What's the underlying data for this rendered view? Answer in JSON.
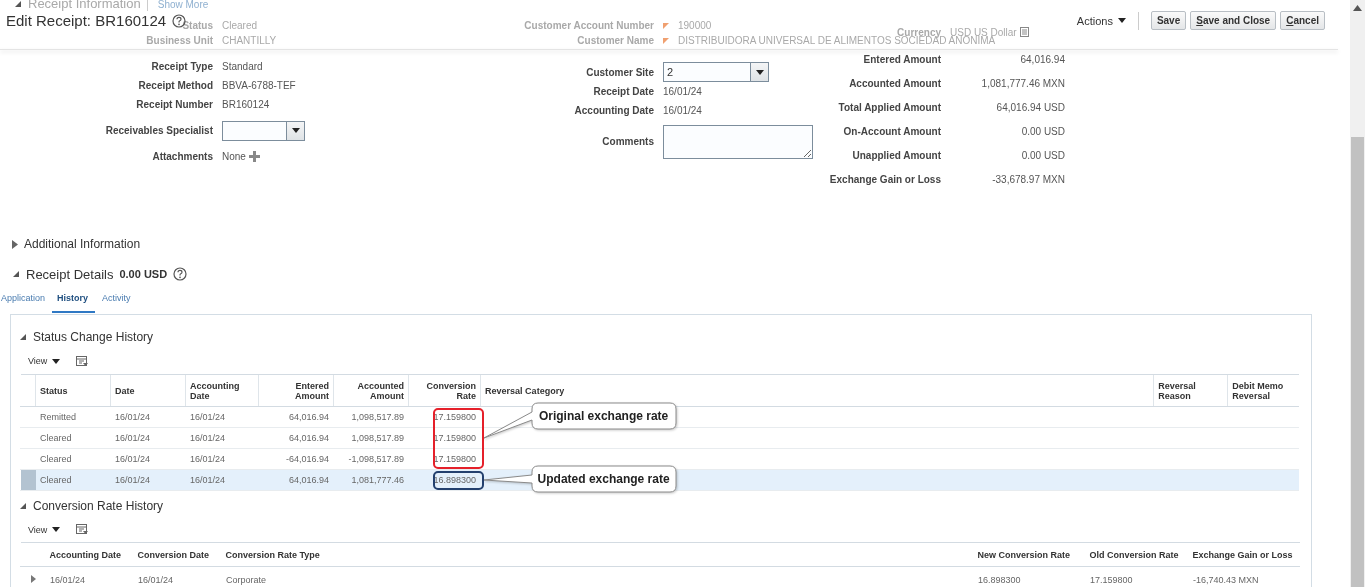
{
  "header": {
    "title": "Edit Receipt: BR160124",
    "actions_menu": "Actions",
    "buttons": [
      {
        "label": "Save",
        "underline_first": false
      },
      {
        "label": "Save and Close",
        "underline_first": true
      },
      {
        "label": "Cancel",
        "underline_first": true
      }
    ]
  },
  "receipt_information": {
    "title": "Receipt Information",
    "expanded": true,
    "dimmed": true,
    "show_more": "Show More",
    "column_1": [
      {
        "kind": "text",
        "label": "Status",
        "value": "Cleared",
        "dimmed": true
      },
      {
        "kind": "text",
        "label": "Business Unit",
        "value": "CHANTILLY",
        "dimmed": true
      },
      {
        "kind": "text",
        "label": "Receipt Type",
        "value": "Standard",
        "dimmed": false
      },
      {
        "kind": "text",
        "label": "Receipt Method",
        "value": "BBVA-6788-TEF",
        "dimmed": false
      },
      {
        "kind": "text",
        "label": "Receipt Number",
        "value": "BR160124",
        "dimmed": false
      },
      {
        "kind": "select",
        "label": "Receivables Specialist",
        "dimmed": false
      },
      {
        "kind": "attachments",
        "label": "Attachments",
        "value": "None",
        "dimmed": false
      }
    ],
    "column_2": [
      {
        "kind": "flagged",
        "label": "Customer Account Number",
        "value": "190000",
        "dimmed": true
      },
      {
        "kind": "flagged",
        "label": "Customer Name",
        "value": "DISTRIBUIDORA UNIVERSAL DE ALIMENTOS SOCIEDAD ANONIMA",
        "dimmed": true
      },
      {
        "kind": "select",
        "label": "Customer Site",
        "value": "2",
        "dimmed": false
      },
      {
        "kind": "text",
        "label": "Receipt Date",
        "value": "16/01/24",
        "dimmed": false
      },
      {
        "kind": "text",
        "label": "Accounting Date",
        "value": "16/01/24",
        "dimmed": false
      },
      {
        "kind": "textarea",
        "label": "Comments",
        "dimmed": false
      }
    ],
    "column_3": [
      {
        "kind": "currency",
        "label": "Currency",
        "value": "USD US Dollar",
        "dimmed": true
      },
      {
        "kind": "amount",
        "label": "Entered Amount",
        "value": "64,016.94",
        "dimmed": false
      },
      {
        "kind": "amount",
        "label": "Accounted Amount",
        "value": "1,081,777.46 MXN",
        "dimmed": false
      },
      {
        "kind": "amount",
        "label": "Total Applied Amount",
        "value": "64,016.94 USD",
        "dimmed": false
      },
      {
        "kind": "amount",
        "label": "On-Account Amount",
        "value": "0.00 USD",
        "dimmed": false
      },
      {
        "kind": "amount",
        "label": "Unapplied Amount",
        "value": "0.00 USD",
        "dimmed": false
      },
      {
        "kind": "amount",
        "label": "Exchange Gain or Loss",
        "value": "-33,678.97 MXN",
        "dimmed": false
      }
    ]
  },
  "additional_information": {
    "title": "Additional Information",
    "expanded": false
  },
  "receipt_details": {
    "title": "Receipt Details",
    "total": "0.00 USD",
    "expanded": true,
    "tabs": [
      {
        "label": "Application",
        "selected": false
      },
      {
        "label": "History",
        "selected": true
      },
      {
        "label": "Activity",
        "selected": false
      }
    ]
  },
  "status_change_history": {
    "title": "Status Change History",
    "expanded": true,
    "view_menu": "View",
    "columns": [
      {
        "label": "Status",
        "kind": "text"
      },
      {
        "label": "Date",
        "kind": "text"
      },
      {
        "label": "Accounting Date",
        "kind": "text"
      },
      {
        "label": "Entered Amount",
        "kind": "number"
      },
      {
        "label": "Accounted Amount",
        "kind": "number"
      },
      {
        "label": "Conversion Rate",
        "kind": "number"
      },
      {
        "label": "Reversal Category",
        "kind": "text"
      },
      {
        "label": "Reversal Reason",
        "kind": "text"
      },
      {
        "label": "Debit Memo Reversal",
        "kind": "text"
      }
    ],
    "rows": [
      {
        "selected": false,
        "outlined": true,
        "cells": [
          "Remitted",
          "16/01/24",
          "16/01/24",
          "64,016.94",
          "1,098,517.89",
          "17.159800"
        ]
      },
      {
        "selected": false,
        "outlined": true,
        "cells": [
          "Cleared",
          "16/01/24",
          "16/01/24",
          "64,016.94",
          "1,098,517.89",
          "17.159800"
        ]
      },
      {
        "selected": false,
        "outlined": true,
        "cells": [
          "Cleared",
          "16/01/24",
          "16/01/24",
          "-64,016.94",
          "-1,098,517.89",
          "17.159800"
        ]
      },
      {
        "selected": true,
        "outlined": true,
        "cells": [
          "Cleared",
          "16/01/24",
          "16/01/24",
          "64,016.94",
          "1,081,777.46",
          "16.898300"
        ]
      }
    ]
  },
  "callouts": [
    {
      "text": "Original exchange rate",
      "color": "#e5202a"
    },
    {
      "text": "Updated exchange rate",
      "color": "#23406e"
    }
  ],
  "conversion_rate_history": {
    "title": "Conversion Rate History",
    "expanded": true,
    "view_menu": "View",
    "columns": [
      "Accounting Date",
      "Conversion Date",
      "Conversion Rate Type",
      "New Conversion Rate",
      "Old Conversion Rate",
      "Exchange Gain or Loss"
    ],
    "rows": [
      {
        "expanded": false,
        "cells": [
          "16/01/24",
          "16/01/24",
          "Corporate",
          "16.898300",
          "17.159800",
          "-16,740.43 MXN"
        ]
      }
    ]
  }
}
